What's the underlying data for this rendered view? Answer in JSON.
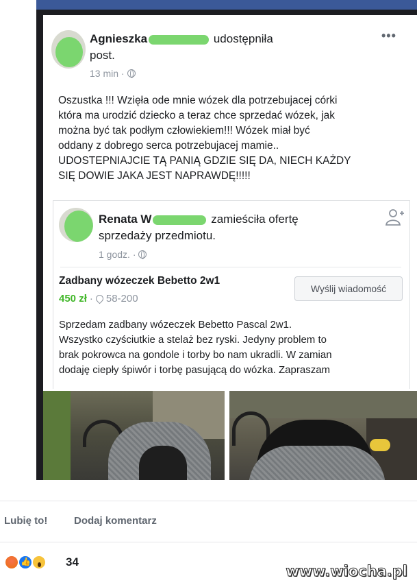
{
  "post": {
    "author_first": "Agnieszka",
    "action": "udostępniła",
    "action_line2": "post.",
    "time": "13 min ·",
    "text_lines": [
      "Oszustka !!! Wzięła ode mnie wózek dla potrzebujacej córki",
      "która ma urodzić dziecko a teraz chce sprzedać wózek, jak",
      "można być tak podłym człowiekiem!!! Wózek miał być",
      "oddany z dobrego serca potrzebujacej mamie..",
      "UDOSTEPNIAJCIE TĄ PANIĄ GDZIE SIĘ DA, NIECH KAŻDY",
      "SIĘ DOWIE JAKA JEST NAPRAWDĘ!!!!!"
    ]
  },
  "shared": {
    "author_first": "Renata",
    "author_last_visible": "W",
    "action": "zamieściła ofertę",
    "action_line2": "sprzedaży przedmiotu.",
    "time": "1 godz. ·",
    "listing_title": "Zadbany wózeczek Bebetto 2w1",
    "price": "450 zł",
    "separator": "·",
    "location": "58-200",
    "message_button": "Wyślij wiadomość",
    "desc_lines": [
      "Sprzedam zadbany wózeczek Bebetto Pascal 2w1.",
      "Wszystko czyściutkie a stelaż bez ryski. Jedyny problem to",
      "brak pokrowca na gondole i torby bo nam ukradli. W zamian",
      "dodaję ciepły śpiwór i torbę pasującą do wózka. Zapraszam"
    ]
  },
  "actions": {
    "like": "Lubię to!",
    "comment": "Dodaj komentarz"
  },
  "reactions": {
    "icons": [
      "angry-icon",
      "like-icon",
      "wow-icon"
    ],
    "count": "34"
  },
  "watermark": "www.wiocha.pl",
  "colors": {
    "facebook_blue": "#3b5998",
    "price_green": "#42b72a",
    "scribble_green": "#7bd66f"
  }
}
